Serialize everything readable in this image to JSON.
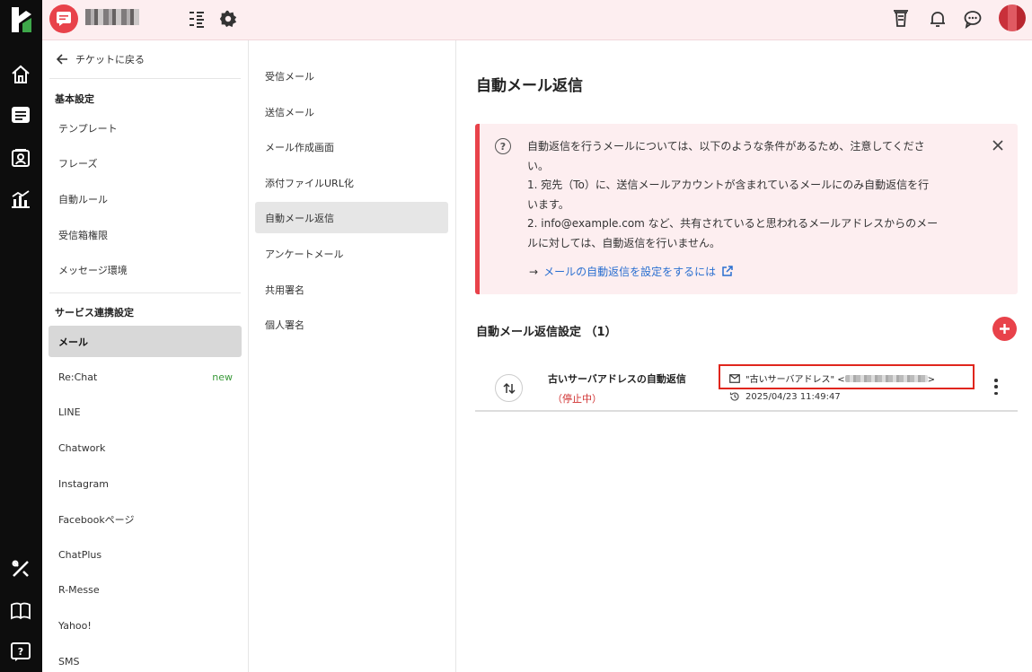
{
  "header": {
    "colors": {
      "accent": "#e8424a",
      "header_bg": "#fdeef0",
      "rail_bg": "#0d0d0d"
    },
    "icons": [
      "menu-list-icon",
      "gear-icon",
      "trash-icon",
      "bell-icon",
      "chat-bubble-icon"
    ]
  },
  "rail": {
    "icons": [
      "logo-icon",
      "home-icon",
      "ticket-icon",
      "contacts-icon",
      "analytics-icon",
      "tools-icon",
      "book-icon",
      "help-icon"
    ]
  },
  "settings": {
    "back_label": "チケットに戻る",
    "section1_title": "基本設定",
    "section1_items": [
      "テンプレート",
      "フレーズ",
      "自動ルール",
      "受信箱権限",
      "メッセージ環境"
    ],
    "section2_title": "サービス連携設定",
    "section2_items": [
      "メール",
      "Re:Chat",
      "LINE",
      "Chatwork",
      "Instagram",
      "Facebookページ",
      "ChatPlus",
      "R-Messe",
      "Yahoo!",
      "SMS"
    ],
    "new_badge": "new"
  },
  "submenu": {
    "items": [
      "受信メール",
      "送信メール",
      "メール作成画面",
      "添付ファイルURL化",
      "自動メール返信",
      "アンケートメール",
      "共用署名",
      "個人署名"
    ]
  },
  "main": {
    "title": "自動メール返信",
    "alert": {
      "line1": "自動返信を行うメールについては、以下のような条件があるため、注意してくださ",
      "line2": "い。",
      "line3": "1. 宛先（To）に、送信メールアカウントが含まれているメールにのみ自動返信を行",
      "line4": "います。",
      "line5": "2. info@example.com など、共有されていると思われるメールアドレスからのメー",
      "line6": "ルに対しては、自動返信を行いません。",
      "link_arrow": "→",
      "link_text": "メールの自動返信を設定をするには"
    },
    "section_title": "自動メール返信設定 （1）",
    "rule": {
      "name": "古いサーバアドレスの自動返信",
      "status": "（停止中）",
      "address_prefix": "\"古いサーバアドレス\" <",
      "address_suffix": ">",
      "datetime": "2025/04/23 11:49:47"
    }
  }
}
